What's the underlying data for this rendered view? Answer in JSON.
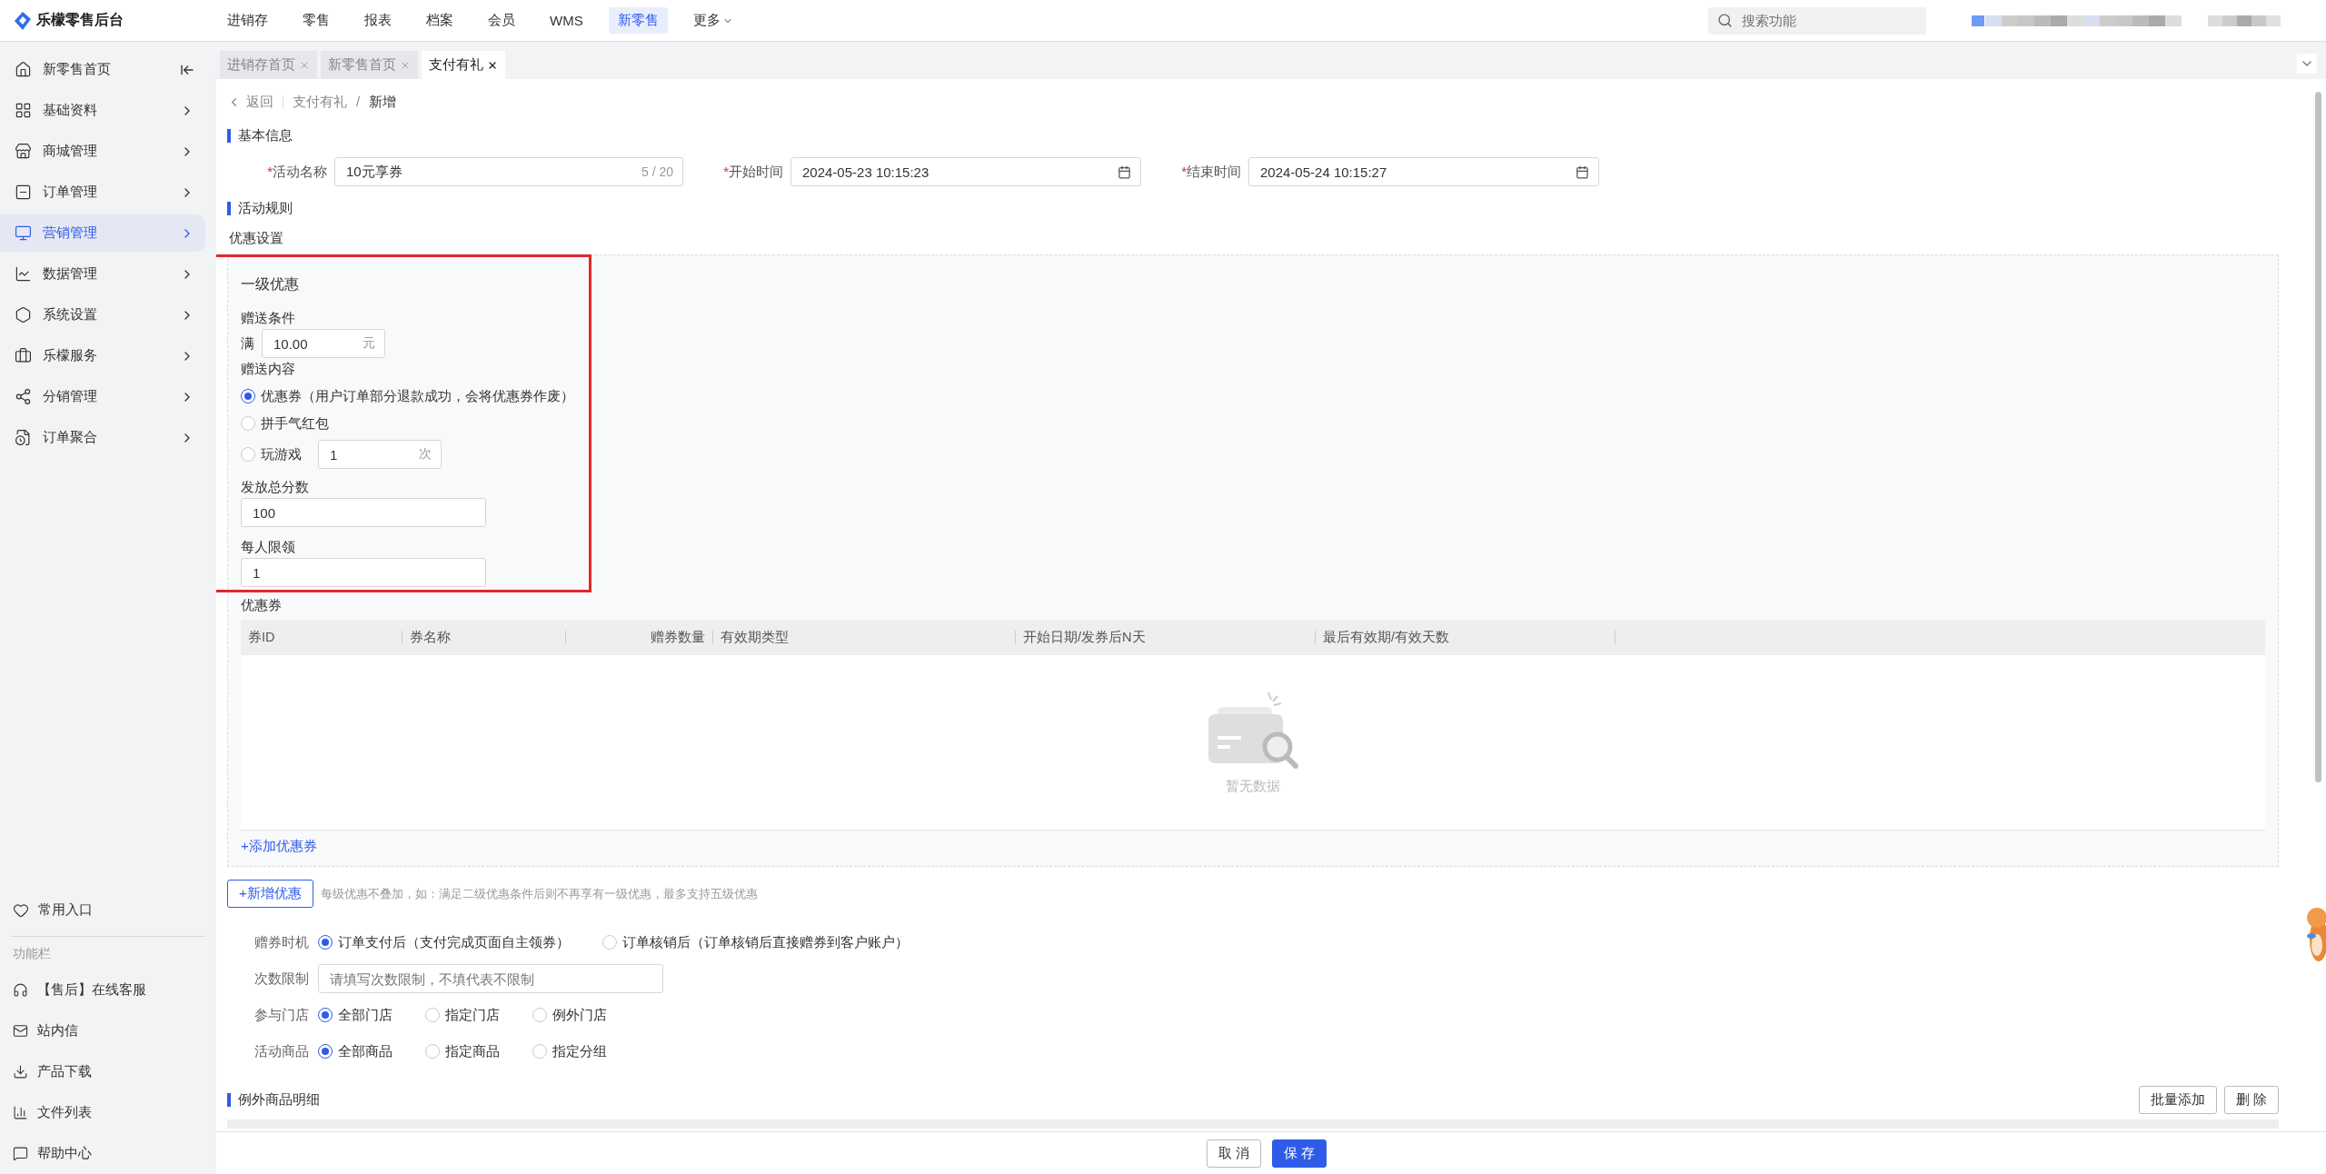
{
  "app": {
    "title": "乐檬零售后台"
  },
  "top_nav": [
    {
      "label": "进销存",
      "selected": false
    },
    {
      "label": "零售",
      "selected": false
    },
    {
      "label": "报表",
      "selected": false
    },
    {
      "label": "档案",
      "selected": false
    },
    {
      "label": "会员",
      "selected": false
    },
    {
      "label": "WMS",
      "selected": false
    },
    {
      "label": "新零售",
      "selected": true
    },
    {
      "label": "更多",
      "selected": false,
      "kind": "dropdown"
    }
  ],
  "search": {
    "placeholder": "搜索功能"
  },
  "sidebar": {
    "items": [
      {
        "label": "新零售首页",
        "selected": false,
        "kind": "home"
      },
      {
        "label": "基础资料",
        "selected": false,
        "kind": "menu"
      },
      {
        "label": "商城管理",
        "selected": false,
        "kind": "menu"
      },
      {
        "label": "订单管理",
        "selected": false,
        "kind": "menu"
      },
      {
        "label": "营销管理",
        "selected": true,
        "kind": "menu"
      },
      {
        "label": "数据管理",
        "selected": false,
        "kind": "menu"
      },
      {
        "label": "系统设置",
        "selected": false,
        "kind": "menu"
      },
      {
        "label": "乐檬服务",
        "selected": false,
        "kind": "menu"
      },
      {
        "label": "分销管理",
        "selected": false,
        "kind": "menu"
      },
      {
        "label": "订单聚合",
        "selected": false,
        "kind": "menu"
      }
    ],
    "shortcut": "常用入口",
    "function_bar": {
      "title": "功能栏",
      "items": [
        "【售后】在线客服",
        "站内信",
        "产品下载",
        "文件列表",
        "帮助中心"
      ]
    }
  },
  "tabs": [
    {
      "label": "进销存首页",
      "selected": false
    },
    {
      "label": "新零售首页",
      "selected": false
    },
    {
      "label": "支付有礼",
      "selected": true
    }
  ],
  "breadcrumb": {
    "back": "返回",
    "separator": "/",
    "path": [
      "支付有礼",
      "新增"
    ]
  },
  "basic_info": {
    "title": "基本信息",
    "fields": [
      {
        "label": "活动名称",
        "required_mark": "*",
        "kind": "text",
        "value": "10元享券",
        "counter": "5 / 20"
      },
      {
        "label": "开始时间",
        "required_mark": "*",
        "kind": "date",
        "value": "2024-05-23 10:15:23"
      },
      {
        "label": "结束时间",
        "required_mark": "*",
        "kind": "date",
        "value": "2024-05-24 10:15:27"
      }
    ]
  },
  "rules": {
    "title": "活动规则",
    "subtitle": "优惠设置",
    "tiers": [
      {
        "title": "一级优惠",
        "condition_label": "赠送条件",
        "condition_prefix": "满",
        "condition_value": "10.00",
        "condition_unit": "元",
        "content_label": "赠送内容",
        "options": [
          {
            "label": "优惠券（用户订单部分退款成功，会将优惠券作废）",
            "selected": true
          },
          {
            "label": "拼手气红包",
            "selected": false
          },
          {
            "label": "玩游戏",
            "selected": false,
            "value": "1",
            "unit": "次"
          }
        ],
        "total_label": "发放总分数",
        "total_value": "100",
        "limit_label": "每人限领",
        "limit_value": "1",
        "coupon_title": "优惠券",
        "columns": [
          {
            "label": "券ID",
            "numeric": false
          },
          {
            "label": "券名称",
            "numeric": false
          },
          {
            "label": "赠券数量",
            "numeric": true
          },
          {
            "label": "有效期类型",
            "numeric": false
          },
          {
            "label": "开始日期/发券后N天",
            "numeric": false
          },
          {
            "label": "最后有效期/有效天数",
            "numeric": false
          }
        ],
        "empty_text": "暂无数据",
        "add_link": "+添加优惠券"
      }
    ],
    "add_tier": {
      "button": "+新增优惠",
      "hint": "每级优惠不叠加，如：满足二级优惠条件后则不再享有一级优惠，最多支持五级优惠"
    }
  },
  "settings": [
    {
      "label": "赠券时机",
      "kind": "radio",
      "options": [
        {
          "label": "订单支付后（支付完成页面自主领券）",
          "selected": true
        },
        {
          "label": "订单核销后（订单核销后直接赠券到客户账户）",
          "selected": false
        }
      ]
    },
    {
      "label": "次数限制",
      "kind": "input",
      "placeholder": "请填写次数限制，不填代表不限制"
    },
    {
      "label": "参与门店",
      "kind": "radio",
      "options": [
        {
          "label": "全部门店",
          "selected": true
        },
        {
          "label": "指定门店",
          "selected": false
        },
        {
          "label": "例外门店",
          "selected": false
        }
      ]
    },
    {
      "label": "活动商品",
      "kind": "radio",
      "options": [
        {
          "label": "全部商品",
          "selected": true
        },
        {
          "label": "指定商品",
          "selected": false
        },
        {
          "label": "指定分组",
          "selected": false
        }
      ]
    }
  ],
  "exclusions": {
    "title": "例外商品明细",
    "buttons": [
      "批量添加",
      "删 除"
    ]
  },
  "footer": {
    "buttons": [
      {
        "label": "取 消",
        "primary": false
      },
      {
        "label": "保 存",
        "primary": true
      }
    ]
  }
}
